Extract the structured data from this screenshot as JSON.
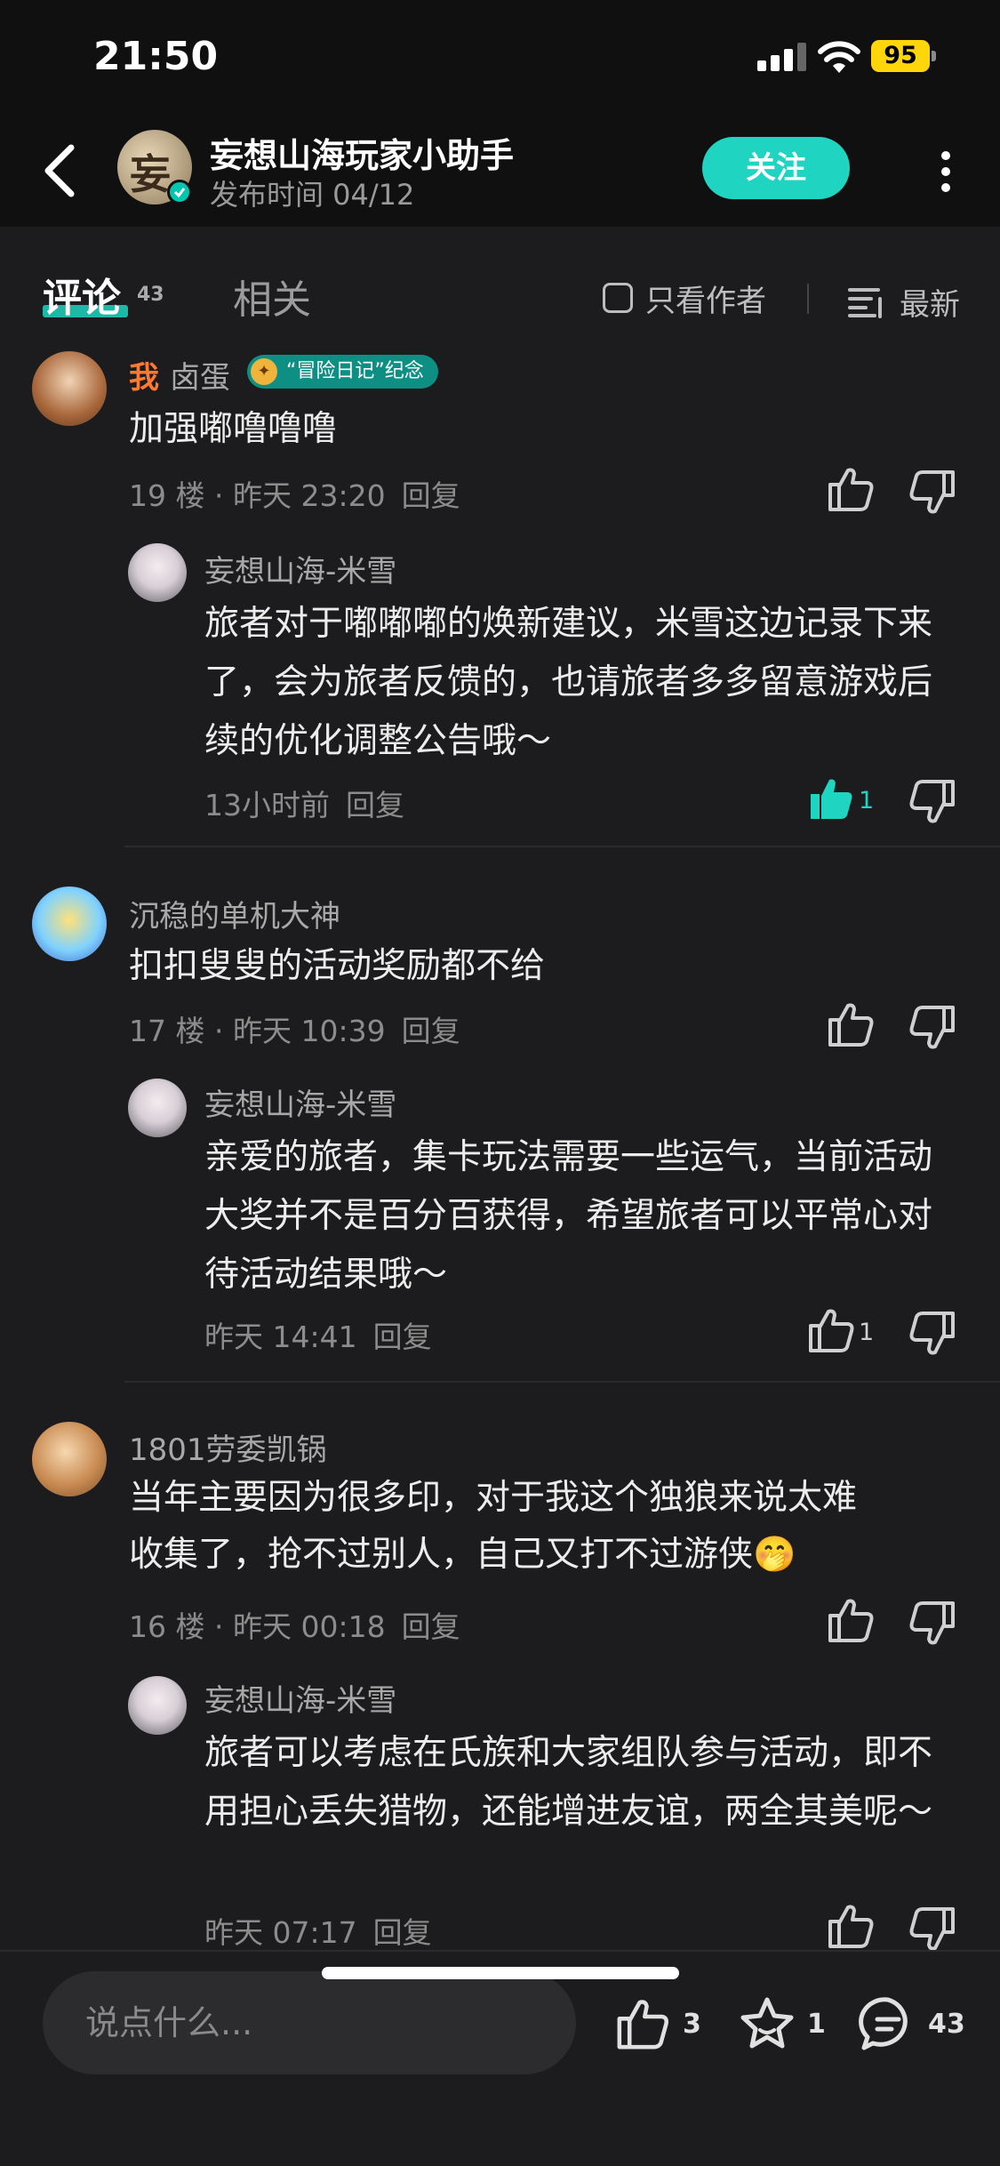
{
  "status": {
    "time": "21:50",
    "battery": "95"
  },
  "header": {
    "title": "妄想山海玩家小助手",
    "subtitle": "发布时间 04/12",
    "follow_label": "关注",
    "avatar_glyph": "妄"
  },
  "tabs": {
    "comments_label": "评论",
    "comments_count": "43",
    "related_label": "相关",
    "author_only_label": "只看作者",
    "sort_label": "最新"
  },
  "comments": [
    {
      "me_tag": "我",
      "name": "卤蛋",
      "badge": "“冒险日记”纪念",
      "text": "加强嘟噜噜噜",
      "floor": "19 楼",
      "time": "昨天 23:20",
      "reply_label": "回复",
      "reply": {
        "name": "妄想山海-米雪",
        "text": "旅者对于嘟嘟嘟的焕新建议，米雪这边记录下来了，会为旅者反馈的，也请旅者多多留意游戏后续的优化调整公告哦～",
        "time": "13小时前",
        "reply_label": "回复",
        "likes": "1",
        "liked": true
      }
    },
    {
      "name": "沉稳的单机大神",
      "text": "扣扣叟叟的活动奖励都不给",
      "floor": "17 楼",
      "time": "昨天 10:39",
      "reply_label": "回复",
      "reply": {
        "name": "妄想山海-米雪",
        "text": "亲爱的旅者，集卡玩法需要一些运气，当前活动大奖并不是百分百获得，希望旅者可以平常心对待活动结果哦～",
        "time": "昨天 14:41",
        "reply_label": "回复",
        "likes": "1",
        "liked": false
      }
    },
    {
      "name": "1801劳委凯锅",
      "text": "当年主要因为很多印，对于我这个独狼来说太难收集了，抢不过别人，自己又打不过游侠",
      "emoji": "🤭",
      "floor": "16 楼",
      "time": "昨天 00:18",
      "reply_label": "回复",
      "reply": {
        "name": "妄想山海-米雪",
        "text": "旅者可以考虑在氏族和大家组队参与活动，即不用担心丢失猎物，还能增进友谊，两全其美呢～",
        "time": "昨天 07:17",
        "reply_label": "回复"
      }
    }
  ],
  "bottom": {
    "input_placeholder": "说点什么...",
    "like_count": "3",
    "fav_count": "1",
    "comment_count": "43"
  },
  "colors": {
    "accent": "#1fd4c0",
    "me": "#ff7a2f",
    "background": "#1c1c1e"
  },
  "icons": [
    "back-icon",
    "verified-icon",
    "more-icon",
    "checkbox-icon",
    "sort-icon",
    "thumb-up-icon",
    "thumb-down-icon",
    "star-icon",
    "comment-icon",
    "signal-icon",
    "wifi-icon",
    "battery-icon"
  ]
}
